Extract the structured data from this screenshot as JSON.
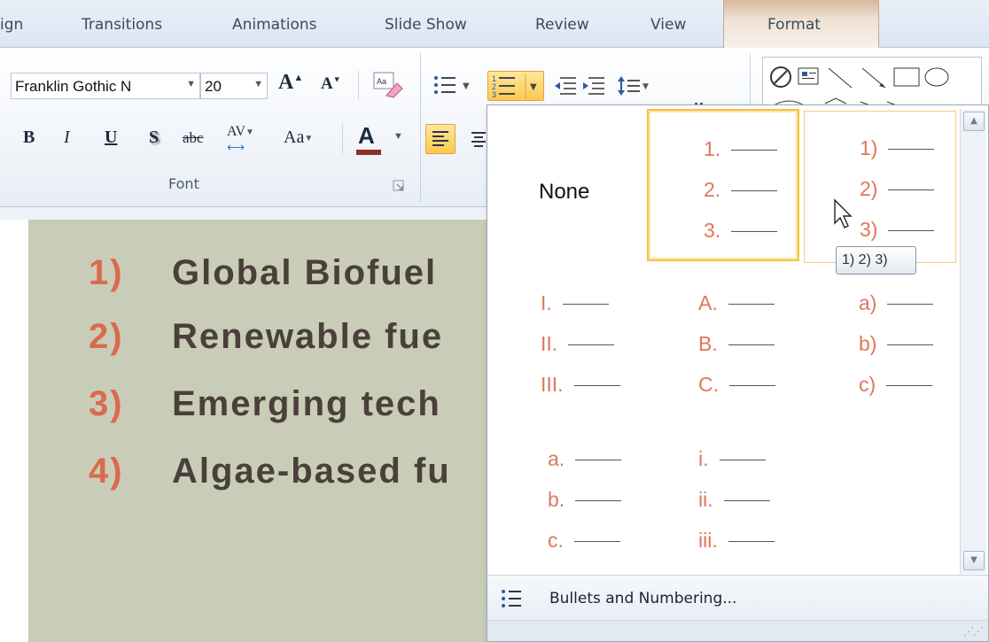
{
  "tabs": {
    "design_partial": "ign",
    "transitions": "Transitions",
    "animations": "Animations",
    "slide_show": "Slide Show",
    "review": "Review",
    "view": "View",
    "format": "Format"
  },
  "font_group": {
    "font_name": "Franklin Gothic N",
    "font_size": "20",
    "label": "Font",
    "grow_font": "A",
    "shrink_font": "A",
    "bold": "B",
    "italic": "I",
    "underline": "U",
    "shadow": "S",
    "strikethrough": "abc",
    "char_spacing": "AV",
    "change_case": "Aa",
    "font_color": "A"
  },
  "colors": {
    "accent_number": "#d96b4f",
    "gallery_number": "#e0765c",
    "slide_bg": "#c9cdb7",
    "highlight": "#f2c14e"
  },
  "slide": {
    "items": [
      {
        "num": "1)",
        "text": "Global Biofuel"
      },
      {
        "num": "2)",
        "text": "Renewable fue"
      },
      {
        "num": "3)",
        "text": "Emerging tech"
      },
      {
        "num": "4)",
        "text": "Algae-based fu"
      }
    ]
  },
  "numbering_gallery": {
    "none_label": "None",
    "styles": [
      {
        "name": "numeric-period",
        "markers": [
          "1.",
          "2.",
          "3."
        ]
      },
      {
        "name": "numeric-paren",
        "markers": [
          "1)",
          "2)",
          "3)"
        ]
      },
      {
        "name": "roman-upper",
        "markers": [
          "I.",
          "II.",
          "III."
        ]
      },
      {
        "name": "alpha-upper",
        "markers": [
          "A.",
          "B.",
          "C."
        ]
      },
      {
        "name": "alpha-lower-paren",
        "markers": [
          "a)",
          "b)",
          "c)"
        ]
      },
      {
        "name": "alpha-lower-period",
        "markers": [
          "a.",
          "b.",
          "c."
        ]
      },
      {
        "name": "roman-lower",
        "markers": [
          "i.",
          "ii.",
          "iii."
        ]
      }
    ],
    "tooltip": "1) 2) 3)",
    "footer_label": "Bullets and Numbering..."
  }
}
